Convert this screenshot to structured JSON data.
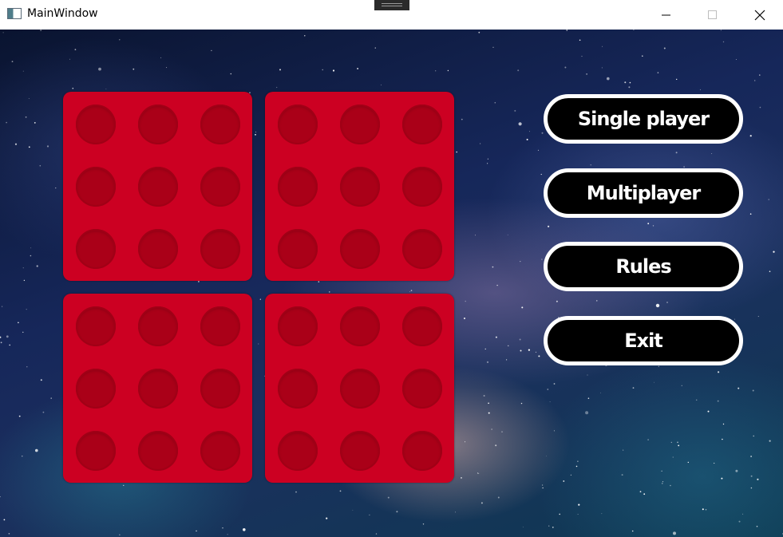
{
  "window": {
    "title": "MainWindow",
    "icon": "app-window-icon",
    "controls": [
      "minimize-icon",
      "maximize-icon",
      "close-icon"
    ]
  },
  "board": {
    "tile_color": "#cc0022",
    "hole_color": "#aa0018",
    "tiles": 4,
    "holes_per_tile": 9
  },
  "menu": {
    "single_player": "Single player",
    "multiplayer": "Multiplayer",
    "rules": "Rules",
    "exit": "Exit"
  },
  "colors": {
    "button_bg": "#000000",
    "button_border": "#ffffff",
    "button_text": "#ffffff"
  }
}
